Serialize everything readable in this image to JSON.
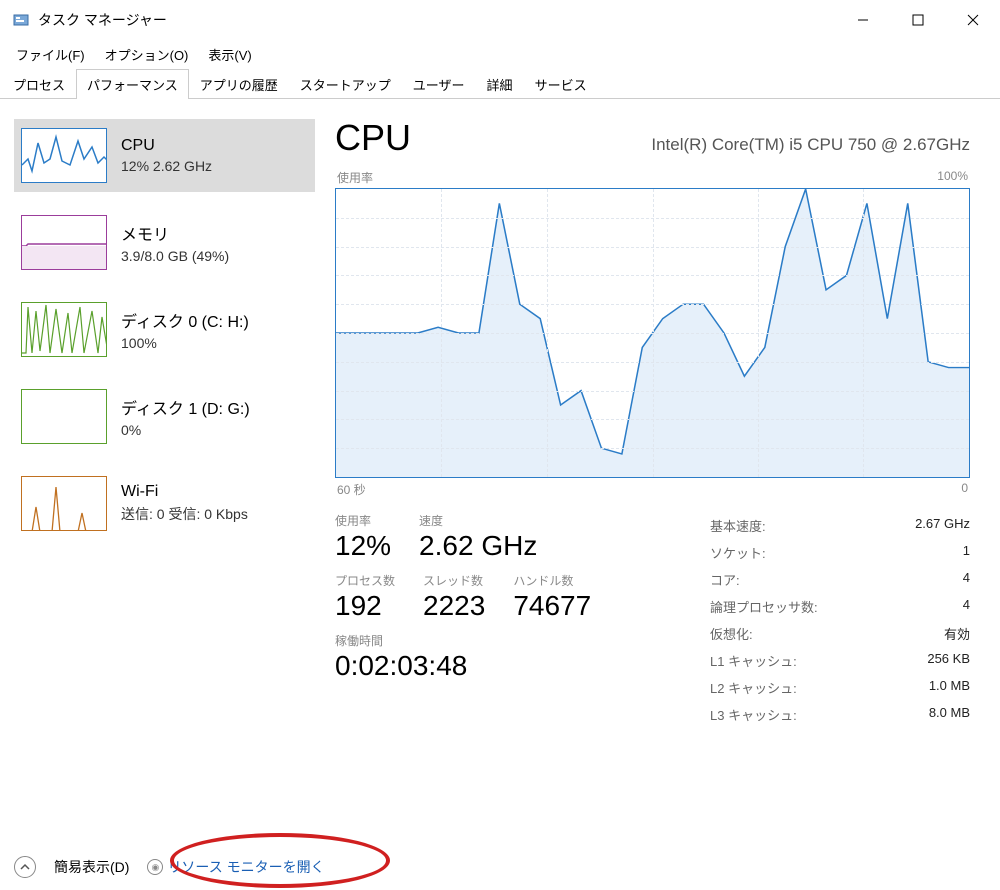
{
  "title": "タスク マネージャー",
  "menus": [
    "ファイル(F)",
    "オプション(O)",
    "表示(V)"
  ],
  "tabs": [
    "プロセス",
    "パフォーマンス",
    "アプリの履歴",
    "スタートアップ",
    "ユーザー",
    "詳細",
    "サービス"
  ],
  "active_tab": 1,
  "sidebar": [
    {
      "title": "CPU",
      "sub": "12%  2.62 GHz",
      "color": "#2b7cc7",
      "active": true
    },
    {
      "title": "メモリ",
      "sub": "3.9/8.0 GB (49%)",
      "color": "#9b3d9b",
      "active": false
    },
    {
      "title": "ディスク 0 (C: H:)",
      "sub": "100%",
      "color": "#5aa02c",
      "active": false
    },
    {
      "title": "ディスク 1 (D: G:)",
      "sub": "0%",
      "color": "#5aa02c",
      "active": false
    },
    {
      "title": "Wi-Fi",
      "sub": "送信: 0  受信: 0 Kbps",
      "color": "#c07020",
      "active": false
    }
  ],
  "main": {
    "title": "CPU",
    "subtitle": "Intel(R) Core(TM) i5 CPU 750 @ 2.67GHz",
    "graph_top_left": "使用率",
    "graph_top_right": "100%",
    "graph_bottom_left": "60 秒",
    "graph_bottom_right": "0",
    "stats": {
      "usage_label": "使用率",
      "usage": "12%",
      "speed_label": "速度",
      "speed": "2.62 GHz",
      "processes_label": "プロセス数",
      "processes": "192",
      "threads_label": "スレッド数",
      "threads": "2223",
      "handles_label": "ハンドル数",
      "handles": "74677",
      "uptime_label": "稼働時間",
      "uptime": "0:02:03:48"
    },
    "specs": [
      {
        "label": "基本速度:",
        "value": "2.67 GHz"
      },
      {
        "label": "ソケット:",
        "value": "1"
      },
      {
        "label": "コア:",
        "value": "4"
      },
      {
        "label": "論理プロセッサ数:",
        "value": "4"
      },
      {
        "label": "仮想化:",
        "value": "有効"
      },
      {
        "label": "L1 キャッシュ:",
        "value": "256 KB"
      },
      {
        "label": "L2 キャッシュ:",
        "value": "1.0 MB"
      },
      {
        "label": "L3 キャッシュ:",
        "value": "8.0 MB"
      }
    ]
  },
  "bottom": {
    "simple_view": "簡易表示(D)",
    "resource_monitor": "リソース モニターを開く"
  },
  "chart_data": {
    "type": "line",
    "title": "CPU 使用率",
    "ylabel": "使用率 (%)",
    "xlabel": "秒",
    "ylim": [
      0,
      100
    ],
    "xlim_seconds": [
      60,
      0
    ],
    "values": [
      50,
      50,
      50,
      50,
      50,
      52,
      50,
      50,
      95,
      60,
      55,
      25,
      30,
      10,
      8,
      45,
      55,
      60,
      60,
      50,
      35,
      45,
      80,
      100,
      65,
      70,
      95,
      55,
      95,
      40,
      38,
      38
    ]
  }
}
